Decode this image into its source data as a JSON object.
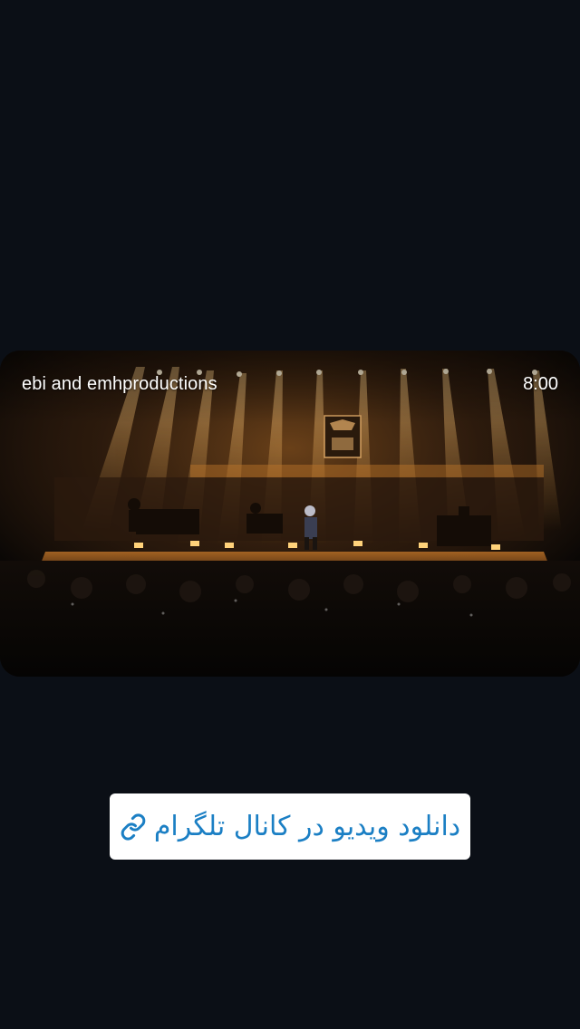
{
  "video": {
    "channel_name": "ebi and emhproductions",
    "duration": "8:00",
    "thumbnail": "concert-stage-scene"
  },
  "download_button": {
    "label": "دانلود ویدیو در کانال تلگرام",
    "icon": "link-icon",
    "text_color": "#1b7fc4",
    "background": "#ffffff"
  },
  "colors": {
    "page_background": "#0b0f16",
    "stage_light": "#ffb347"
  }
}
